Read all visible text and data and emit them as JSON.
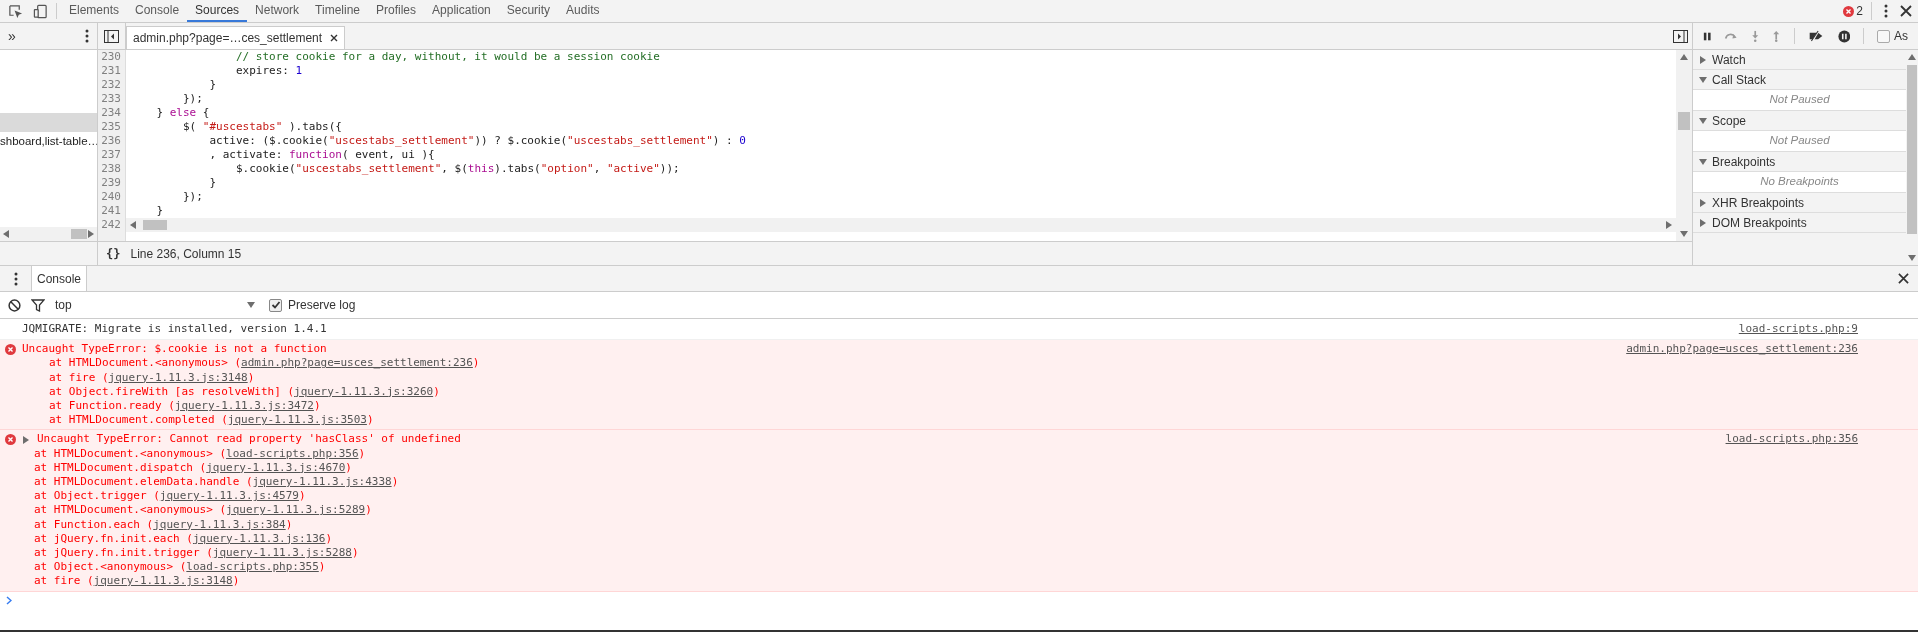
{
  "main_tabs": [
    {
      "label": "Elements",
      "selected": false
    },
    {
      "label": "Console",
      "selected": false
    },
    {
      "label": "Sources",
      "selected": true
    },
    {
      "label": "Network",
      "selected": false
    },
    {
      "label": "Timeline",
      "selected": false
    },
    {
      "label": "Profiles",
      "selected": false
    },
    {
      "label": "Application",
      "selected": false
    },
    {
      "label": "Security",
      "selected": false
    },
    {
      "label": "Audits",
      "selected": false
    }
  ],
  "error_count": "2",
  "navigator": {
    "more_tabs": "»",
    "items": [
      {
        "selected": true
      },
      {
        "label": "shboard,list-table…",
        "selected": false
      }
    ]
  },
  "editor": {
    "file_tab": {
      "label": "admin.php?page=…ces_settlement"
    },
    "lines": [
      {
        "number": "230",
        "tokens": [
          {
            "kind": "comment",
            "text": "                // store cookie for a day, without, it would be a session cookie"
          }
        ]
      },
      {
        "number": "231",
        "tokens": [
          {
            "kind": "plain",
            "text": "                expires: "
          },
          {
            "kind": "number",
            "text": "1"
          }
        ]
      },
      {
        "number": "232",
        "tokens": [
          {
            "kind": "plain",
            "text": "            }"
          }
        ]
      },
      {
        "number": "233",
        "tokens": [
          {
            "kind": "plain",
            "text": "        });"
          }
        ]
      },
      {
        "number": "234",
        "tokens": [
          {
            "kind": "plain",
            "text": "    } "
          },
          {
            "kind": "keyword",
            "text": "else"
          },
          {
            "kind": "plain",
            "text": " {"
          }
        ]
      },
      {
        "number": "235",
        "tokens": [
          {
            "kind": "plain",
            "text": "        $( "
          },
          {
            "kind": "string",
            "text": "\"#uscestabs\""
          },
          {
            "kind": "plain",
            "text": " ).tabs({"
          }
        ]
      },
      {
        "number": "236",
        "tokens": [
          {
            "kind": "plain",
            "text": "            active: ($.cookie("
          },
          {
            "kind": "string",
            "text": "\"uscestabs_settlement\""
          },
          {
            "kind": "plain",
            "text": ")) ? $.cookie("
          },
          {
            "kind": "string",
            "text": "\"uscestabs_settlement\""
          },
          {
            "kind": "plain",
            "text": ") : "
          },
          {
            "kind": "number",
            "text": "0"
          }
        ]
      },
      {
        "number": "237",
        "tokens": [
          {
            "kind": "plain",
            "text": "            , activate: "
          },
          {
            "kind": "keyword",
            "text": "function"
          },
          {
            "kind": "plain",
            "text": "( event, ui ){"
          }
        ]
      },
      {
        "number": "238",
        "tokens": [
          {
            "kind": "plain",
            "text": "                $.cookie("
          },
          {
            "kind": "string",
            "text": "\"uscestabs_settlement\""
          },
          {
            "kind": "plain",
            "text": ", $("
          },
          {
            "kind": "keyword",
            "text": "this"
          },
          {
            "kind": "plain",
            "text": ").tabs("
          },
          {
            "kind": "string",
            "text": "\"option\""
          },
          {
            "kind": "plain",
            "text": ", "
          },
          {
            "kind": "string",
            "text": "\"active\""
          },
          {
            "kind": "plain",
            "text": "));"
          }
        ]
      },
      {
        "number": "239",
        "tokens": [
          {
            "kind": "plain",
            "text": "            }"
          }
        ]
      },
      {
        "number": "240",
        "tokens": [
          {
            "kind": "plain",
            "text": "        });"
          }
        ]
      },
      {
        "number": "241",
        "tokens": [
          {
            "kind": "plain",
            "text": "    }"
          }
        ]
      },
      {
        "number": "242"
      }
    ],
    "pretty_print": "{}",
    "status": "Line 236, Column 15"
  },
  "debugger": {
    "async_checkbox": {
      "label": "As",
      "checked": false
    },
    "sections": [
      {
        "title": "Watch",
        "expanded": false
      },
      {
        "title": "Call Stack",
        "expanded": true,
        "message": "Not Paused"
      },
      {
        "title": "Scope",
        "expanded": true,
        "message": "Not Paused"
      },
      {
        "title": "Breakpoints",
        "expanded": true,
        "message": "No Breakpoints"
      },
      {
        "title": "XHR Breakpoints",
        "expanded": false
      },
      {
        "title": "DOM Breakpoints",
        "expanded": false
      }
    ]
  },
  "drawer": {
    "tab": {
      "label": "Console",
      "selected": true
    },
    "context": "top",
    "preserve_log": {
      "label": "Preserve log",
      "checked": true
    },
    "messages": [
      {
        "kind": "log",
        "text": "JQMIGRATE: Migrate is installed, version 1.4.1",
        "source": "load-scripts.php:9"
      },
      {
        "kind": "error",
        "collapsible": false,
        "text": "Uncaught TypeError: $.cookie is not a function",
        "source": "admin.php?page=usces_settlement:236",
        "stack": [
          {
            "text": "at HTMLDocument.<anonymous> (",
            "link": "admin.php?page=usces_settlement:236",
            "after": ")"
          },
          {
            "text": "at fire (",
            "link": "jquery-1.11.3.js:3148",
            "after": ")"
          },
          {
            "text": "at Object.fireWith [as resolveWith] (",
            "link": "jquery-1.11.3.js:3260",
            "after": ")"
          },
          {
            "text": "at Function.ready (",
            "link": "jquery-1.11.3.js:3472",
            "after": ")"
          },
          {
            "text": "at HTMLDocument.completed (",
            "link": "jquery-1.11.3.js:3503",
            "after": ")"
          }
        ]
      },
      {
        "kind": "error",
        "collapsible": true,
        "text": "Uncaught TypeError: Cannot read property 'hasClass' of undefined",
        "source": "load-scripts.php:356",
        "stack": [
          {
            "text": "at HTMLDocument.<anonymous> (",
            "link": "load-scripts.php:356",
            "after": ")"
          },
          {
            "text": "at HTMLDocument.dispatch (",
            "link": "jquery-1.11.3.js:4670",
            "after": ")"
          },
          {
            "text": "at HTMLDocument.elemData.handle (",
            "link": "jquery-1.11.3.js:4338",
            "after": ")"
          },
          {
            "text": "at Object.trigger (",
            "link": "jquery-1.11.3.js:4579",
            "after": ")"
          },
          {
            "text": "at HTMLDocument.<anonymous> (",
            "link": "jquery-1.11.3.js:5289",
            "after": ")"
          },
          {
            "text": "at Function.each (",
            "link": "jquery-1.11.3.js:384",
            "after": ")"
          },
          {
            "text": "at jQuery.fn.init.each (",
            "link": "jquery-1.11.3.js:136",
            "after": ")"
          },
          {
            "text": "at jQuery.fn.init.trigger (",
            "link": "jquery-1.11.3.js:5288",
            "after": ")"
          },
          {
            "text": "at Object.<anonymous> (",
            "link": "load-scripts.php:355",
            "after": ")"
          },
          {
            "text": "at fire (",
            "link": "jquery-1.11.3.js:3148",
            "after": ")"
          }
        ]
      }
    ]
  }
}
